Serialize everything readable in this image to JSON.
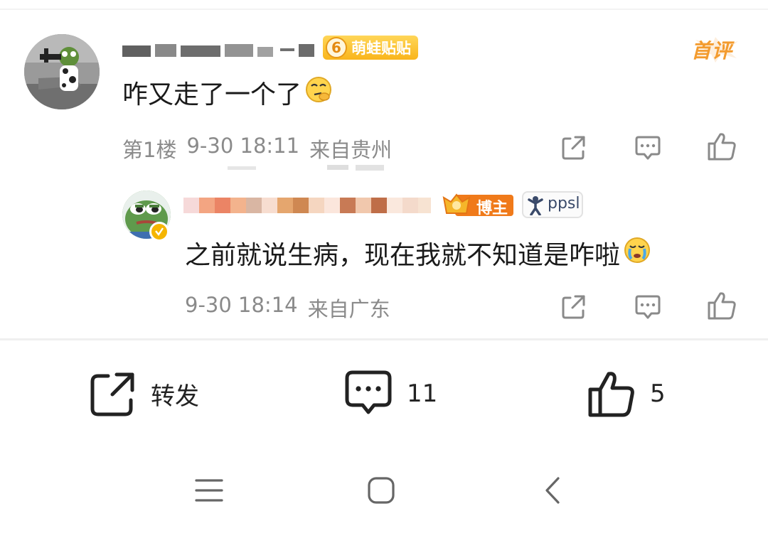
{
  "comment": {
    "fan_badge": {
      "level": "6",
      "label": "萌蛙贴贴"
    },
    "first_tag": "首评",
    "text": "咋又走了一个了",
    "floor": "第1楼",
    "time": "9-30 18:11",
    "location": "来自贵州"
  },
  "reply": {
    "blogger_badge": "博主",
    "ppsl_badge": "ppsl",
    "text": "之前就说生病，现在我就不知道是咋啦",
    "time": "9-30 18:14",
    "location": "来自广东"
  },
  "bottom_bar": {
    "repost_label": "转发",
    "comment_count": "11",
    "like_count": "5"
  },
  "icons": [
    "share-icon",
    "comment-icon",
    "like-icon",
    "menu-icon",
    "home-icon",
    "back-icon"
  ],
  "colors": {
    "fan_badge": "#f9b51b",
    "first_tag": "#f39b2e",
    "meta_text": "#8a8a8a",
    "blogger_badge": "#f07a1a"
  }
}
